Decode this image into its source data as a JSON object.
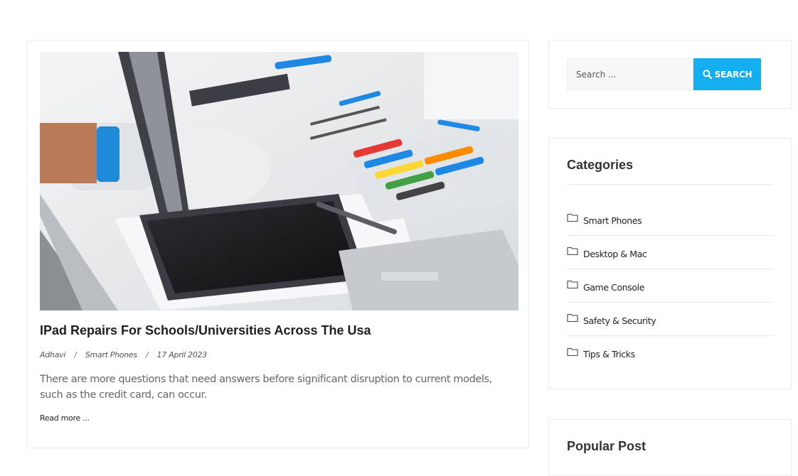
{
  "post": {
    "title": "IPad Repairs For Schools/Universities Across The Usa",
    "author": "Adhavi",
    "category": "Smart Phones",
    "date": "17 April 2023",
    "separator": "/",
    "excerpt": "There are more questions that need answers before significant disruption to current models, such as the credit card, can occur.",
    "read_more": "Read more ..."
  },
  "search": {
    "placeholder": "Search ...",
    "button_label": "SEARCH"
  },
  "categories": {
    "title": "Categories",
    "items": [
      {
        "label": "Smart Phones"
      },
      {
        "label": "Desktop & Mac"
      },
      {
        "label": "Game Console"
      },
      {
        "label": "Safety & Security"
      },
      {
        "label": "Tips & Tricks"
      }
    ]
  },
  "popular": {
    "title": "Popular Post"
  },
  "colors": {
    "accent": "#12aeef",
    "border": "#ececec"
  }
}
